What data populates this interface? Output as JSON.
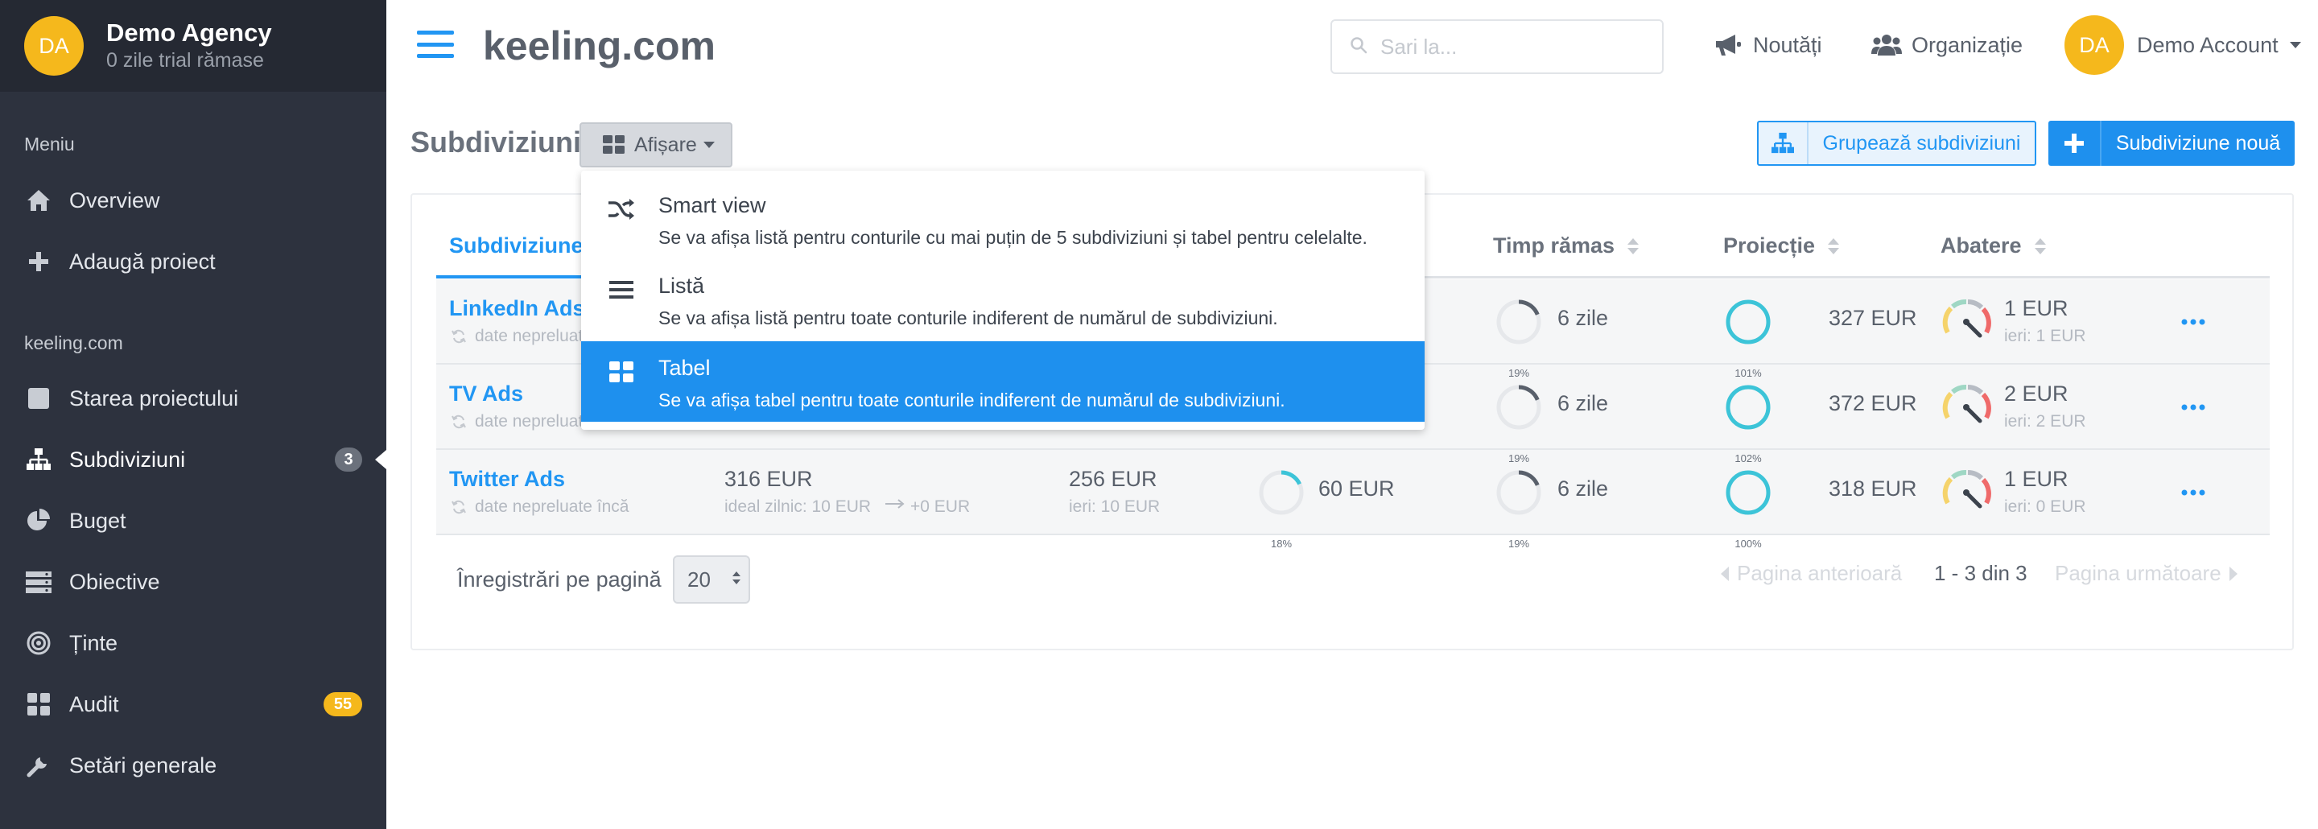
{
  "sidebar": {
    "avatar_initials": "DA",
    "org_name": "Demo Agency",
    "org_trial": "0 zile trial rămase",
    "section_menu": "Meniu",
    "section_project": "keeling.com",
    "items": [
      {
        "label": "Overview",
        "icon": "home-icon"
      },
      {
        "label": "Adaugă proiect",
        "icon": "plus-icon"
      },
      {
        "label": "Starea proiectului",
        "icon": "square-icon"
      },
      {
        "label": "Subdiviziuni",
        "icon": "sitemap-icon",
        "badge": "3"
      },
      {
        "label": "Buget",
        "icon": "pie-chart-icon"
      },
      {
        "label": "Obiective",
        "icon": "server-icon"
      },
      {
        "label": "Ținte",
        "icon": "target-icon"
      },
      {
        "label": "Audit",
        "icon": "grid-icon",
        "badge": "55"
      },
      {
        "label": "Setări generale",
        "icon": "wrench-icon"
      }
    ]
  },
  "header": {
    "site_title": "keeling.com",
    "search_placeholder": "Sari la...",
    "news_label": "Noutăți",
    "org_label": "Organizație",
    "account_initials": "DA",
    "account_label": "Demo Account"
  },
  "page": {
    "title": "Subdiviziuni",
    "view_button": "Afișare",
    "group_button": "Grupează subdiviziuni",
    "new_button": "Subdiviziune nouă"
  },
  "dropdown": {
    "items": [
      {
        "title": "Smart view",
        "desc": "Se va afișa listă pentru conturile cu mai puțin de 5 subdiviziuni și tabel pentru celelalte.",
        "icon": "shuffle-icon",
        "selected": false
      },
      {
        "title": "Listă",
        "desc": "Se va afișa listă pentru toate conturile indiferent de numărul de subdiviziuni.",
        "icon": "list-icon",
        "selected": false
      },
      {
        "title": "Tabel",
        "desc": "Se va afișa tabel pentru toate conturile indiferent de numărul de subdiviziuni.",
        "icon": "grid-icon",
        "selected": true
      }
    ]
  },
  "table": {
    "columns": [
      "Subdiviziune",
      "Timp rămas",
      "Proiecție",
      "Abatere"
    ],
    "rows": [
      {
        "name": "LinkedIn Ads",
        "sub": "date nepreluate încă",
        "time_pct": "19%",
        "time_val": "6 zile",
        "proj_pct": "101%",
        "proj_val": "327 EUR",
        "dev_val": "1 EUR",
        "dev_sub": "ieri: 1 EUR"
      },
      {
        "name": "TV Ads",
        "sub": "date nepreluate încă",
        "time_pct": "19%",
        "time_val": "6 zile",
        "proj_pct": "102%",
        "proj_val": "372 EUR",
        "dev_val": "2 EUR",
        "dev_sub": "ieri: 2 EUR"
      },
      {
        "name": "Twitter Ads",
        "sub": "date nepreluate încă",
        "budget_val": "316 EUR",
        "budget_sub": "ideal zilnic: 10 EUR",
        "budget_delta": "+0 EUR",
        "spent_val": "256 EUR",
        "spent_sub": "ieri: 10 EUR",
        "spend_pct": "18%",
        "spend_val": "60 EUR",
        "time_pct": "19%",
        "time_val": "6 zile",
        "proj_pct": "100%",
        "proj_val": "318 EUR",
        "dev_val": "1 EUR",
        "dev_sub": "ieri: 0 EUR"
      }
    ]
  },
  "pagination": {
    "per_page_label": "Înregistrări pe pagină",
    "per_page_value": "20",
    "prev_label": "Pagina anterioară",
    "info": "1 - 3 din 3",
    "next_label": "Pagina următoare"
  },
  "colors": {
    "accent": "#2196f3",
    "sidebar_bg": "#2d323e",
    "badge_yellow": "#f5b81c",
    "ring_teal": "#3cc4d8",
    "ring_gray": "#59606b"
  }
}
